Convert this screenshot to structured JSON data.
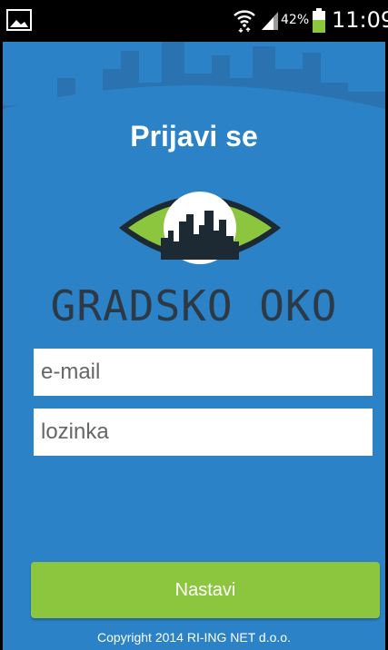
{
  "status_bar": {
    "battery_percent": "42%",
    "time": "11:09",
    "icons": [
      "image-icon",
      "wifi-icon",
      "signal-icon",
      "battery-icon"
    ]
  },
  "login": {
    "title": "Prijavi se",
    "brand_name": "GRADSKO OKO",
    "email_placeholder": "e-mail",
    "email_value": "",
    "password_placeholder": "lozinka",
    "password_value": "",
    "submit_label": "Nastavi",
    "copyright": "Copyright 2014 RI-ING NET d.o.o."
  },
  "colors": {
    "background": "#2b82c6",
    "skyline": "#2a73b0",
    "button": "#8cc63f",
    "brand_text": "#2d3a45",
    "logo_green": "#8cc63f"
  }
}
